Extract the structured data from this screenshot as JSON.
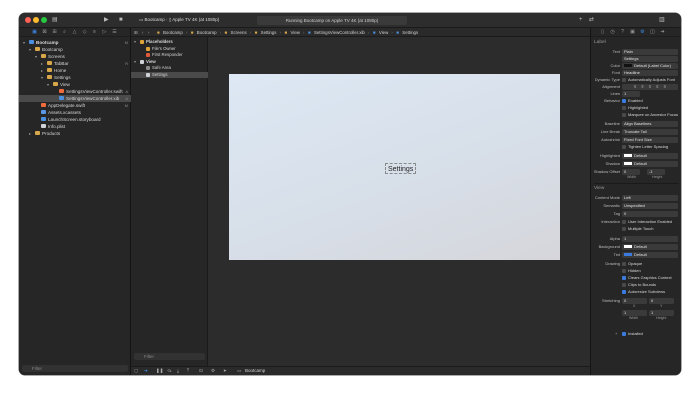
{
  "toolbar": {
    "scheme": "Bootcamp",
    "destination": "Apple TV 4K (at 1080p)",
    "status": "Running Bootcamp on Apple TV 4K (at 1080p)"
  },
  "navigator": {
    "items": [
      {
        "label": "Bootcamp",
        "depth": 0,
        "icon": "project",
        "badge": "M",
        "arrow": "▾"
      },
      {
        "label": "Bootcamp",
        "depth": 1,
        "icon": "folder",
        "badge": "",
        "arrow": "▾"
      },
      {
        "label": "Screens",
        "depth": 2,
        "icon": "folder",
        "badge": "",
        "arrow": "▾"
      },
      {
        "label": "TabBar",
        "depth": 3,
        "icon": "folder",
        "badge": "R",
        "arrow": "▸"
      },
      {
        "label": "Home",
        "depth": 3,
        "icon": "folder",
        "badge": "",
        "arrow": "▸"
      },
      {
        "label": "Settings",
        "depth": 3,
        "icon": "folder",
        "badge": "",
        "arrow": "▾"
      },
      {
        "label": "View",
        "depth": 4,
        "icon": "folder",
        "badge": "",
        "arrow": "▾"
      },
      {
        "label": "SettingsViewController.swift",
        "depth": 5,
        "icon": "swift",
        "badge": "A",
        "arrow": ""
      },
      {
        "label": "SettingsViewController.xib",
        "depth": 5,
        "icon": "xib",
        "badge": "A",
        "arrow": "",
        "selected": true
      },
      {
        "label": "AppDelegate.swift",
        "depth": 2,
        "icon": "swift",
        "badge": "M",
        "arrow": ""
      },
      {
        "label": "Assets.xcassets",
        "depth": 2,
        "icon": "assets",
        "badge": "",
        "arrow": ""
      },
      {
        "label": "LaunchScreen.storyboard",
        "depth": 2,
        "icon": "xib",
        "badge": "",
        "arrow": ""
      },
      {
        "label": "Info.plist",
        "depth": 2,
        "icon": "file",
        "badge": "",
        "arrow": ""
      },
      {
        "label": "Products",
        "depth": 1,
        "icon": "folder",
        "badge": "",
        "arrow": "▸"
      }
    ],
    "filter_placeholder": "Filter"
  },
  "jumpbar": {
    "crumbs": [
      "Bootcamp",
      "Bootcamp",
      "Screens",
      "Settings",
      "View",
      "SettingsViewController.xib",
      "View",
      "Settings"
    ]
  },
  "outline": {
    "items": [
      {
        "label": "Placeholders",
        "depth": 0,
        "arrow": "▾",
        "color": "#e0a33a"
      },
      {
        "label": "File's Owner",
        "depth": 1,
        "arrow": "",
        "color": "#e0a33a"
      },
      {
        "label": "First Responder",
        "depth": 1,
        "arrow": "",
        "color": "#e05a3a"
      },
      {
        "label": "View",
        "depth": 0,
        "arrow": "▾",
        "color": "#cfd3d8"
      },
      {
        "label": "Safe Area",
        "depth": 1,
        "arrow": "",
        "color": "#8a8a8a"
      },
      {
        "label": "Settings",
        "depth": 1,
        "arrow": "",
        "color": "#cfd3d8",
        "selected": true
      }
    ],
    "filter_placeholder": "Filter"
  },
  "canvas": {
    "label_text": "Settings",
    "view_as": "View as: Light Appearance",
    "zoom": "50%"
  },
  "debugbar": {
    "target": "Bootcamp"
  },
  "inspector": {
    "label_section": "Label",
    "text_key": "Text",
    "text_value": "Plain",
    "text_content": "Settings",
    "color_key": "Color",
    "color_value": "Default (Label Color)",
    "font_key": "Font",
    "font_value": "Headline",
    "dynamic_type_key": "Dynamic Type",
    "dynamic_type_value": "Automatically Adjusts Font",
    "alignment_key": "Alignment",
    "lines_key": "Lines",
    "lines_value": "1",
    "behavior_key": "Behavior",
    "behavior_enabled": "Enabled",
    "behavior_highlighted": "Highlighted",
    "behavior_marquee": "Marquee on Ancestor Focus",
    "baseline_key": "Baseline",
    "baseline_value": "Align Baselines",
    "line_break_key": "Line Break",
    "line_break_value": "Truncate Tail",
    "autoshrink_key": "Autoshrink",
    "autoshrink_value": "Fixed Font Size",
    "tighten": "Tighten Letter Spacing",
    "highlighted_key": "Highlighted",
    "highlighted_value": "Default",
    "shadow_key": "Shadow",
    "shadow_value": "Default",
    "shadow_offset_key": "Shadow Offset",
    "shadow_offset_w": "0",
    "shadow_offset_h": "-1",
    "width_label": "Width",
    "height_label": "Height",
    "view_section": "View",
    "content_mode_key": "Content Mode",
    "content_mode_value": "Left",
    "semantic_key": "Semantic",
    "semantic_value": "Unspecified",
    "tag_key": "Tag",
    "tag_value": "0",
    "interaction_key": "Interaction",
    "interaction_user": "User Interaction Enabled",
    "interaction_multi": "Multiple Touch",
    "alpha_key": "Alpha",
    "alpha_value": "1",
    "background_key": "Background",
    "background_value": "Default",
    "tint_key": "Tint",
    "tint_value": "Default",
    "drawing_key": "Drawing",
    "drawing_opaque": "Opaque",
    "drawing_hidden": "Hidden",
    "drawing_clears": "Clears Graphics Context",
    "drawing_clips": "Clips to Bounds",
    "drawing_autoresize": "Autoresize Subviews",
    "stretching_key": "Stretching",
    "stretch_x": "0",
    "stretch_y": "0",
    "stretch_w": "1",
    "stretch_h": "1",
    "stretch_x_label": "X",
    "stretch_y_label": "Y",
    "installed": "Installed"
  },
  "colors": {
    "accent": "#3b7be0",
    "folder": "#d8a74a",
    "swift": "#f26b3a"
  }
}
